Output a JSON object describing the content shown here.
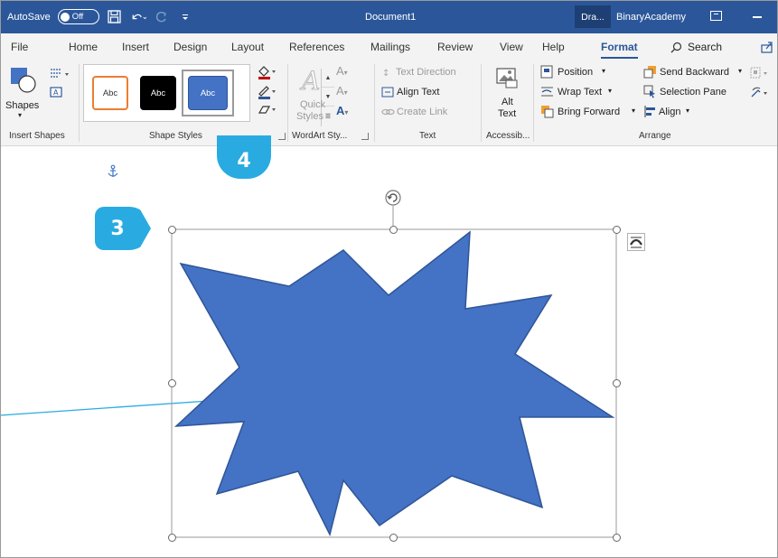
{
  "titlebar": {
    "autosave_label": "AutoSave",
    "autosave_state": "Off",
    "document_title": "Document1",
    "context_tab": "Dra...",
    "user_name": "BinaryAcademy"
  },
  "tabs": [
    {
      "label": "File"
    },
    {
      "label": "Home"
    },
    {
      "label": "Insert"
    },
    {
      "label": "Design"
    },
    {
      "label": "Layout"
    },
    {
      "label": "References"
    },
    {
      "label": "Mailings"
    },
    {
      "label": "Review"
    },
    {
      "label": "View"
    },
    {
      "label": "Help"
    },
    {
      "label": "Format",
      "active": true
    }
  ],
  "search_label": "Search",
  "ribbon": {
    "insert_shapes": {
      "shapes_label": "Shapes",
      "group_label": "Insert Shapes"
    },
    "shape_styles": {
      "swatch_labels": [
        "Abc",
        "Abc",
        "Abc"
      ],
      "group_label": "Shape Styles"
    },
    "wordart": {
      "quick_styles_line1": "Quick",
      "quick_styles_line2": "Styles",
      "group_label": "WordArt Sty..."
    },
    "text": {
      "text_direction": "Text Direction",
      "align_text": "Align Text",
      "create_link": "Create Link",
      "group_label": "Text"
    },
    "accessibility": {
      "alt_line1": "Alt",
      "alt_line2": "Text",
      "group_label": "Accessib..."
    },
    "arrange": {
      "position": "Position",
      "wrap_text": "Wrap Text",
      "bring_forward": "Bring Forward",
      "send_backward": "Send Backward",
      "selection_pane": "Selection Pane",
      "align": "Align",
      "group_label": "Arrange"
    }
  },
  "annotations": {
    "badge_3": "3",
    "badge_4": "4"
  },
  "colors": {
    "title_bar": "#2b579a",
    "accent": "#2b579a",
    "shape_fill": "#4472c4",
    "shape_stroke": "#2f5597",
    "callout": "#29abe2"
  },
  "icons": [
    "save-icon",
    "undo-icon",
    "redo-icon",
    "anchor-icon",
    "rotate-handle-icon",
    "layout-options-icon",
    "search-icon",
    "share-icon"
  ]
}
